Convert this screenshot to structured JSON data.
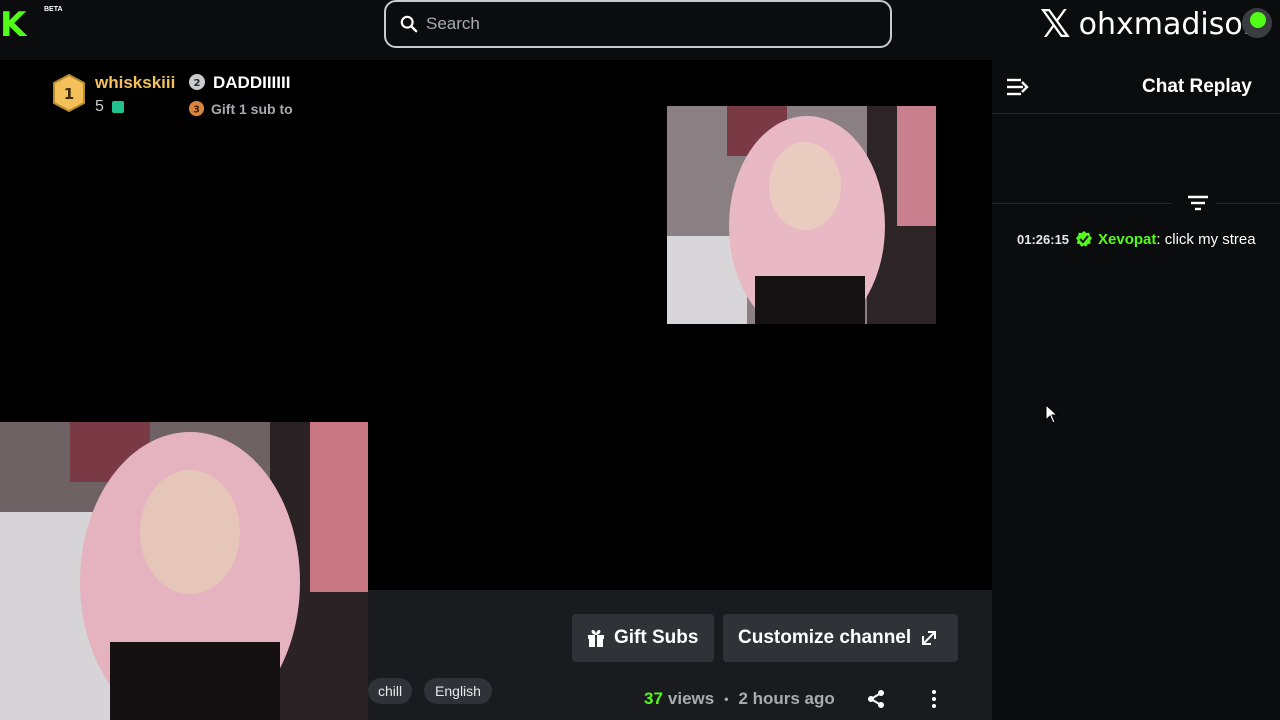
{
  "header": {
    "logo_text": "K",
    "beta_label": "BETA",
    "search_placeholder": "Search",
    "x_logo": "𝕏",
    "x_handle": "ohxmadison"
  },
  "actions": {
    "gift_subs_label": "Gift Subs",
    "customize_label": "Customize channel"
  },
  "tags": [
    "chill",
    "English"
  ],
  "stats": {
    "views_count": "37",
    "views_label": "views",
    "separator": "•",
    "time_ago": "2 hours ago"
  },
  "chat": {
    "title": "Chat Replay",
    "leaderboard": [
      {
        "rank": "1",
        "name": "whiskskiii",
        "score": "5",
        "color": "#f3c05a"
      },
      {
        "rank": "2",
        "name": "DADDIIIIII"
      },
      {
        "rank": "3",
        "text": "Gift 1 sub to"
      }
    ],
    "messages": [
      {
        "time": "01:26:15",
        "user": "Xevopat",
        "text": ": click my strea"
      }
    ]
  },
  "colors": {
    "brand_green": "#53fc18",
    "gold": "#f3c05a",
    "silver": "#c9cbcd",
    "bronze": "#d9843e",
    "panel": "#2f3337"
  }
}
